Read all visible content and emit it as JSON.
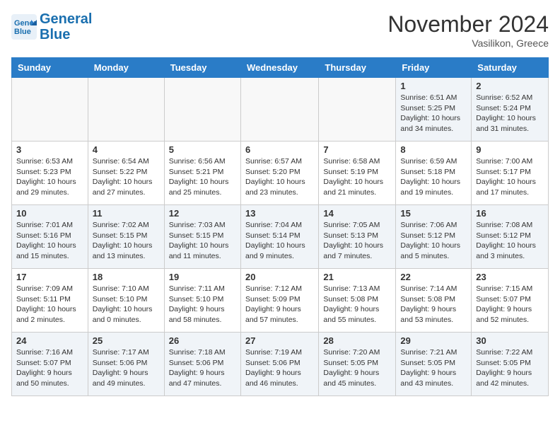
{
  "header": {
    "logo_line1": "General",
    "logo_line2": "Blue",
    "month_title": "November 2024",
    "subtitle": "Vasilikon, Greece"
  },
  "weekdays": [
    "Sunday",
    "Monday",
    "Tuesday",
    "Wednesday",
    "Thursday",
    "Friday",
    "Saturday"
  ],
  "rows": [
    [
      {
        "day": "",
        "info": ""
      },
      {
        "day": "",
        "info": ""
      },
      {
        "day": "",
        "info": ""
      },
      {
        "day": "",
        "info": ""
      },
      {
        "day": "",
        "info": ""
      },
      {
        "day": "1",
        "info": "Sunrise: 6:51 AM\nSunset: 5:25 PM\nDaylight: 10 hours\nand 34 minutes."
      },
      {
        "day": "2",
        "info": "Sunrise: 6:52 AM\nSunset: 5:24 PM\nDaylight: 10 hours\nand 31 minutes."
      }
    ],
    [
      {
        "day": "3",
        "info": "Sunrise: 6:53 AM\nSunset: 5:23 PM\nDaylight: 10 hours\nand 29 minutes."
      },
      {
        "day": "4",
        "info": "Sunrise: 6:54 AM\nSunset: 5:22 PM\nDaylight: 10 hours\nand 27 minutes."
      },
      {
        "day": "5",
        "info": "Sunrise: 6:56 AM\nSunset: 5:21 PM\nDaylight: 10 hours\nand 25 minutes."
      },
      {
        "day": "6",
        "info": "Sunrise: 6:57 AM\nSunset: 5:20 PM\nDaylight: 10 hours\nand 23 minutes."
      },
      {
        "day": "7",
        "info": "Sunrise: 6:58 AM\nSunset: 5:19 PM\nDaylight: 10 hours\nand 21 minutes."
      },
      {
        "day": "8",
        "info": "Sunrise: 6:59 AM\nSunset: 5:18 PM\nDaylight: 10 hours\nand 19 minutes."
      },
      {
        "day": "9",
        "info": "Sunrise: 7:00 AM\nSunset: 5:17 PM\nDaylight: 10 hours\nand 17 minutes."
      }
    ],
    [
      {
        "day": "10",
        "info": "Sunrise: 7:01 AM\nSunset: 5:16 PM\nDaylight: 10 hours\nand 15 minutes."
      },
      {
        "day": "11",
        "info": "Sunrise: 7:02 AM\nSunset: 5:15 PM\nDaylight: 10 hours\nand 13 minutes."
      },
      {
        "day": "12",
        "info": "Sunrise: 7:03 AM\nSunset: 5:15 PM\nDaylight: 10 hours\nand 11 minutes."
      },
      {
        "day": "13",
        "info": "Sunrise: 7:04 AM\nSunset: 5:14 PM\nDaylight: 10 hours\nand 9 minutes."
      },
      {
        "day": "14",
        "info": "Sunrise: 7:05 AM\nSunset: 5:13 PM\nDaylight: 10 hours\nand 7 minutes."
      },
      {
        "day": "15",
        "info": "Sunrise: 7:06 AM\nSunset: 5:12 PM\nDaylight: 10 hours\nand 5 minutes."
      },
      {
        "day": "16",
        "info": "Sunrise: 7:08 AM\nSunset: 5:12 PM\nDaylight: 10 hours\nand 3 minutes."
      }
    ],
    [
      {
        "day": "17",
        "info": "Sunrise: 7:09 AM\nSunset: 5:11 PM\nDaylight: 10 hours\nand 2 minutes."
      },
      {
        "day": "18",
        "info": "Sunrise: 7:10 AM\nSunset: 5:10 PM\nDaylight: 10 hours\nand 0 minutes."
      },
      {
        "day": "19",
        "info": "Sunrise: 7:11 AM\nSunset: 5:10 PM\nDaylight: 9 hours\nand 58 minutes."
      },
      {
        "day": "20",
        "info": "Sunrise: 7:12 AM\nSunset: 5:09 PM\nDaylight: 9 hours\nand 57 minutes."
      },
      {
        "day": "21",
        "info": "Sunrise: 7:13 AM\nSunset: 5:08 PM\nDaylight: 9 hours\nand 55 minutes."
      },
      {
        "day": "22",
        "info": "Sunrise: 7:14 AM\nSunset: 5:08 PM\nDaylight: 9 hours\nand 53 minutes."
      },
      {
        "day": "23",
        "info": "Sunrise: 7:15 AM\nSunset: 5:07 PM\nDaylight: 9 hours\nand 52 minutes."
      }
    ],
    [
      {
        "day": "24",
        "info": "Sunrise: 7:16 AM\nSunset: 5:07 PM\nDaylight: 9 hours\nand 50 minutes."
      },
      {
        "day": "25",
        "info": "Sunrise: 7:17 AM\nSunset: 5:06 PM\nDaylight: 9 hours\nand 49 minutes."
      },
      {
        "day": "26",
        "info": "Sunrise: 7:18 AM\nSunset: 5:06 PM\nDaylight: 9 hours\nand 47 minutes."
      },
      {
        "day": "27",
        "info": "Sunrise: 7:19 AM\nSunset: 5:06 PM\nDaylight: 9 hours\nand 46 minutes."
      },
      {
        "day": "28",
        "info": "Sunrise: 7:20 AM\nSunset: 5:05 PM\nDaylight: 9 hours\nand 45 minutes."
      },
      {
        "day": "29",
        "info": "Sunrise: 7:21 AM\nSunset: 5:05 PM\nDaylight: 9 hours\nand 43 minutes."
      },
      {
        "day": "30",
        "info": "Sunrise: 7:22 AM\nSunset: 5:05 PM\nDaylight: 9 hours\nand 42 minutes."
      }
    ]
  ]
}
